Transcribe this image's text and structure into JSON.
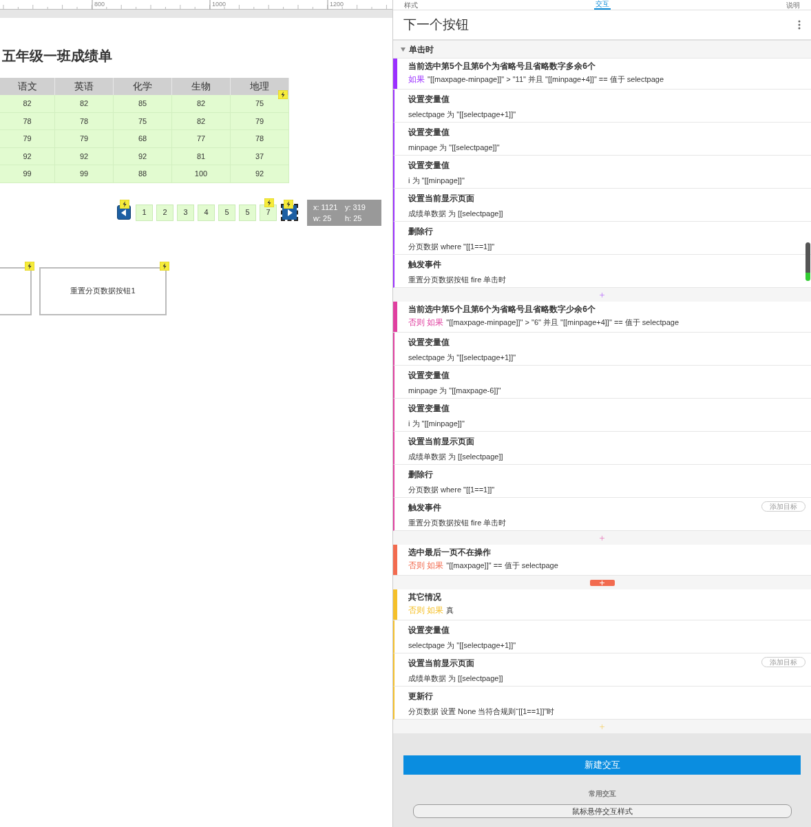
{
  "canvas": {
    "ruler_labels": [
      "800",
      "1000",
      "1200"
    ],
    "title": "五年级一班成绩单",
    "table": {
      "columns": [
        "语文",
        "英语",
        "化学",
        "生物",
        "地理"
      ],
      "rows": [
        [
          "82",
          "82",
          "85",
          "82",
          "75"
        ],
        [
          "78",
          "78",
          "75",
          "82",
          "79"
        ],
        [
          "79",
          "79",
          "68",
          "77",
          "78"
        ],
        [
          "92",
          "92",
          "92",
          "81",
          "37"
        ],
        [
          "99",
          "99",
          "88",
          "100",
          "92"
        ]
      ]
    },
    "pagination": {
      "pages": [
        {
          "label": "1"
        },
        {
          "label": "2"
        },
        {
          "label": "3"
        },
        {
          "label": "4"
        },
        {
          "label": "5"
        },
        {
          "label": "5"
        },
        {
          "label": "7"
        }
      ],
      "next_selected": true
    },
    "tooltip": [
      "x: 1121",
      "y: 319",
      "w: 25",
      "h: 25"
    ],
    "boxes": [
      {
        "kind": "blank"
      },
      {
        "kind": "labeled",
        "label": "重置分页数据按钮1"
      }
    ]
  },
  "panel": {
    "tabs": [
      {
        "label": "样式",
        "selected": false
      },
      {
        "label": "交互",
        "selected": true
      },
      {
        "label": "说明",
        "selected": false
      }
    ],
    "widget_title": "下一个按钮",
    "event": {
      "label": "单击时",
      "expanded": true
    },
    "cases": [
      {
        "name": "当前选中第5个且第6个为省略号且省略数字多余6个",
        "color": "#9b30ff",
        "prefix": "如果",
        "condition": "\"[[maxpage-minpage]]\" > \"11\" 并且 \"[[minpage+4]]\" == 值于 selectpage",
        "separator_active": false,
        "actions": [
          {
            "title": "设置变量值",
            "detail": "selectpage 为 \"[[selectpage+1]]\"",
            "add_target": false
          },
          {
            "title": "设置变量值",
            "detail": "minpage 为 \"[[selectpage]]\"",
            "add_target": false
          },
          {
            "title": "设置变量值",
            "detail": "i 为 \"[[minpage]]\"",
            "add_target": false
          },
          {
            "title": "设置当前显示页面",
            "detail": "成绩单数据 为 [[selectpage]]",
            "add_target": false
          },
          {
            "title": "删除行",
            "detail": "分页数据 where \"[[1==1]]\"",
            "add_target": false
          },
          {
            "title": "触发事件",
            "detail": "重置分页数据按钮 fire 单击时",
            "add_target": false
          }
        ]
      },
      {
        "name": "当前选中第5个且第6个为省略号且省略数字少余6个",
        "color": "#e040a0",
        "prefix": "否则 如果",
        "condition": "\"[[maxpage-minpage]]\" > \"6\" 并且 \"[[minpage+4]]\" == 值于 selectpage",
        "separator_active": false,
        "actions": [
          {
            "title": "设置变量值",
            "detail": "selectpage 为 \"[[selectpage+1]]\"",
            "add_target": false
          },
          {
            "title": "设置变量值",
            "detail": "minpage 为 \"[[maxpage-6]]\"",
            "add_target": false
          },
          {
            "title": "设置变量值",
            "detail": "i 为 \"[[minpage]]\"",
            "add_target": false
          },
          {
            "title": "设置当前显示页面",
            "detail": "成绩单数据 为 [[selectpage]]",
            "add_target": false
          },
          {
            "title": "删除行",
            "detail": "分页数据 where \"[[1==1]]\"",
            "add_target": false
          },
          {
            "title": "触发事件",
            "detail": "重置分页数据按钮 fire 单击时",
            "add_target": true,
            "target_label": "添加目标"
          }
        ]
      },
      {
        "name": "选中最后一页不在操作",
        "color": "#f26b4f",
        "prefix": "否则 如果",
        "condition": "\"[[maxpage]]\" == 值于 selectpage",
        "separator_active": true
      },
      {
        "name": "其它情况",
        "color": "#f5c02a",
        "prefix": "否则 如果",
        "condition": "真",
        "separator_active": false,
        "actions": [
          {
            "title": "设置变量值",
            "detail": "selectpage 为 \"[[selectpage+1]]\"",
            "add_target": false
          },
          {
            "title": "设置当前显示页面",
            "detail": "成绩单数据 为 [[selectpage]]",
            "add_target": true,
            "target_label": "添加目标"
          },
          {
            "title": "更新行",
            "detail": "分页数据 设置 None 当符合规则“[[1==1]]”时",
            "add_target": false
          }
        ]
      }
    ],
    "new_button": "新建交互",
    "common_label": "常用交互",
    "common_button": "鼠标悬停交互样式"
  }
}
